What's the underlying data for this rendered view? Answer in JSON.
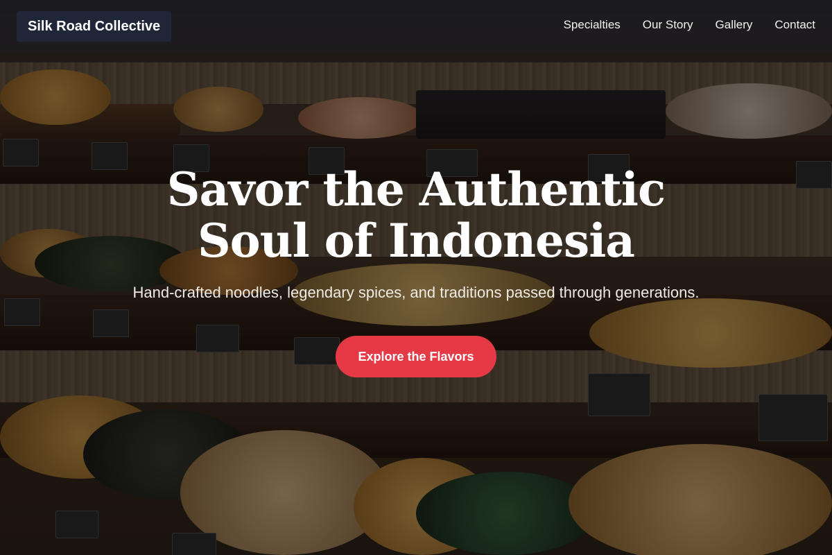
{
  "header": {
    "brand": "Silk Road Collective",
    "nav": [
      {
        "label": "Specialties"
      },
      {
        "label": "Our Story"
      },
      {
        "label": "Gallery"
      },
      {
        "label": "Contact"
      }
    ]
  },
  "hero": {
    "title": "Savor the Authentic Soul of Indonesia",
    "subtitle": "Hand-crafted noodles, legendary spices, and traditions passed through generations.",
    "cta_label": "Explore the Flavors",
    "background_image": "food-market-shelves-photo"
  },
  "colors": {
    "accent": "#e63946",
    "brand_bg": "#1e283c",
    "text": "#ffffff"
  }
}
